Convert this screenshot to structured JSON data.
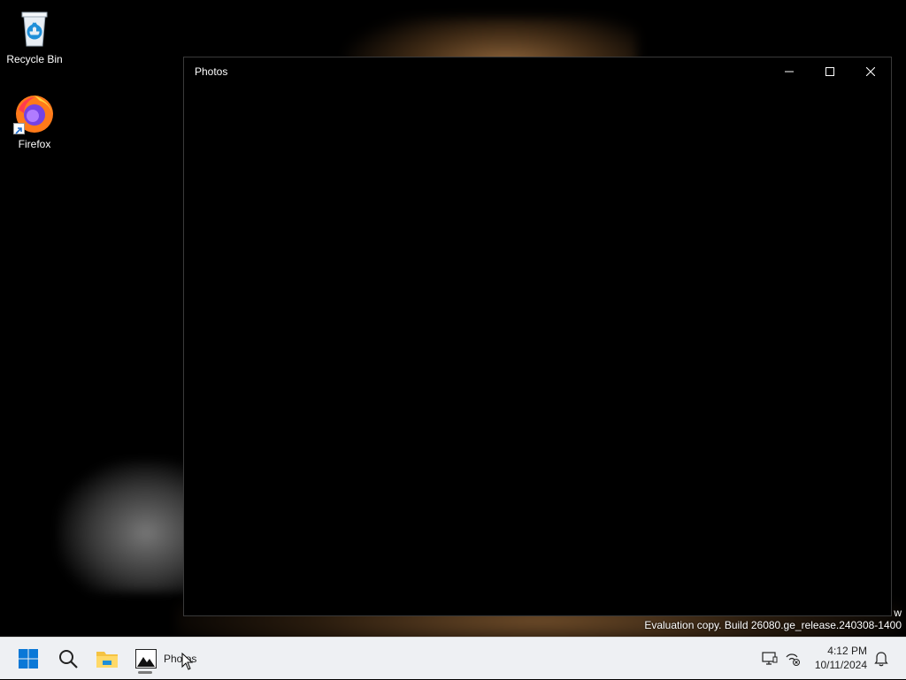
{
  "desktop": {
    "icons": [
      {
        "label": "Recycle Bin"
      },
      {
        "label": "Firefox"
      }
    ]
  },
  "window": {
    "title": "Photos",
    "controls": [
      "minimize",
      "maximize",
      "close"
    ]
  },
  "watermark": {
    "cut_text": "w",
    "text": "Evaluation copy. Build 26080.ge_release.240308-1400"
  },
  "taskbar": {
    "start_icon": "windows-start-icon",
    "search_icon": "search-icon",
    "explorer_icon": "file-explorer-icon",
    "photos_icon": "photos-icon",
    "photos_label": "Photos",
    "tray_icons": [
      "display-icon",
      "network-disconnected-icon"
    ],
    "time": "4:12 PM",
    "date": "10/11/2024",
    "notification_icon": "bell-icon"
  },
  "colors": {
    "taskbar_bg": "#eef0f3",
    "start_blue": "#0a78d7",
    "folder_yellow": "#f5c342"
  }
}
